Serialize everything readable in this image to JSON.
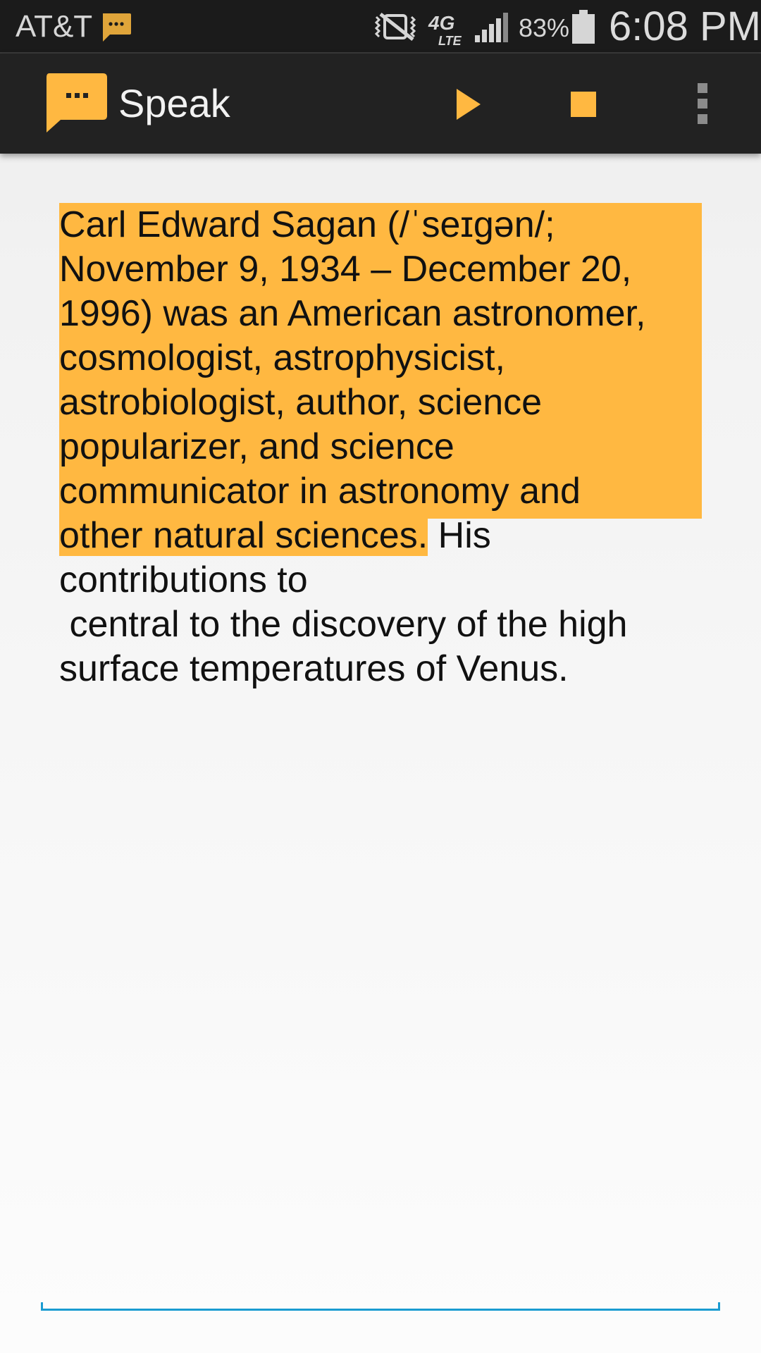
{
  "status_bar": {
    "carrier": "AT&T",
    "notification_icon": "speak-app-notification-icon",
    "network": "4G LTE",
    "battery_percent": "83%",
    "time": "6:08 PM"
  },
  "app_bar": {
    "title": "Speak",
    "logo_icon": "speech-bubble-icon",
    "actions": [
      {
        "name": "play",
        "icon": "play-icon"
      },
      {
        "name": "stop",
        "icon": "stop-icon"
      },
      {
        "name": "more",
        "icon": "overflow-menu-icon"
      }
    ]
  },
  "content": {
    "line1_spoken": "Carl Edward Sagan (/ˈseɪɡən/;",
    "line2_spoken": "November 9, 1934 – December 20,",
    "line3_spoken": "1996) was an American astronomer,",
    "line4_spoken": "cosmologist, astrophysicist,",
    "line5_spoken": "astrobiologist, author, science",
    "line6_spoken": "popularizer, and science",
    "line7_spoken": "communicator in astronomy and",
    "line8_spoken": "other natural sciences.",
    "line8_rest": " His",
    "line9": "contributions to",
    "line10": " central to the discovery of the high",
    "line11": "surface temperatures of Venus."
  },
  "colors": {
    "accent": "#ffb841",
    "app_bar": "#222222",
    "status_bar": "#1b1b1b",
    "text_field_underline": "#1a9bd1"
  }
}
